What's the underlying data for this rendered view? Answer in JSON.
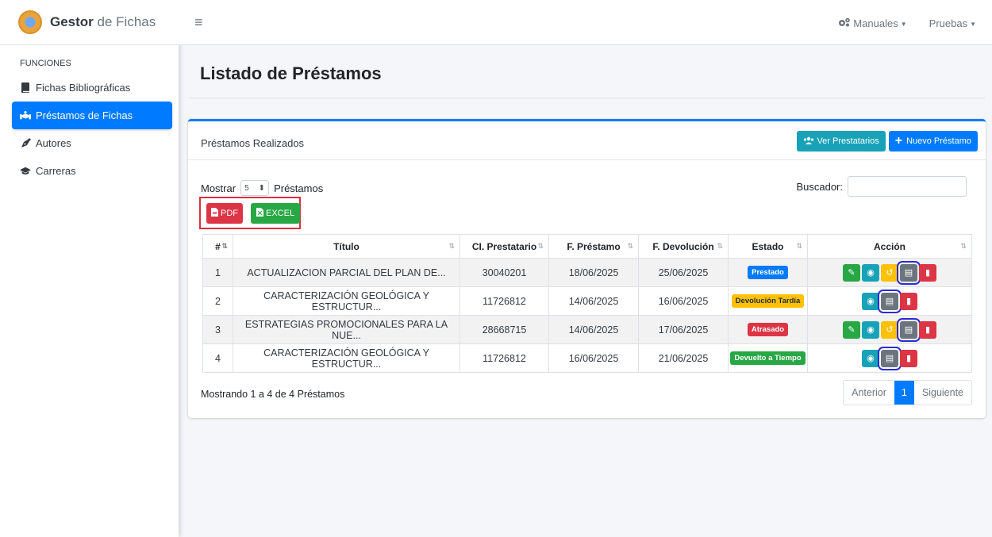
{
  "brand": {
    "bold": "Gestor",
    "rest": "de Fichas"
  },
  "sidebar": {
    "header": "FUNCIONES",
    "items": [
      {
        "label": "Fichas Bibliográficas",
        "icon": "book-icon",
        "active": false
      },
      {
        "label": "Préstamos de Fichas",
        "icon": "hands-icon",
        "active": true
      },
      {
        "label": "Autores",
        "icon": "pen-nib-icon",
        "active": false
      },
      {
        "label": "Carreras",
        "icon": "graduation-cap-icon",
        "active": false
      }
    ]
  },
  "topbar": {
    "manuals": "Manuales",
    "user": "Pruebas"
  },
  "page": {
    "title": "Listado de Préstamos"
  },
  "card": {
    "title": "Préstamos Realizados",
    "ver_prestatarios": "Ver Prestatarios",
    "nuevo_prestamo": "Nuevo Préstamo",
    "show_label": "Mostrar",
    "show_value": "5",
    "show_suffix": "Préstamos",
    "search_label": "Buscador:",
    "pdf_label": "PDF",
    "excel_label": "EXCEL"
  },
  "table": {
    "headers": [
      "#",
      "Título",
      "CI. Prestatario",
      "F. Préstamo",
      "F. Devolución",
      "Estado",
      "Acción"
    ],
    "rows": [
      {
        "n": "1",
        "titulo": "ACTUALIZACION PARCIAL DEL PLAN DE...",
        "ci": "30040201",
        "prestamo": "18/06/2025",
        "devolucion": "25/06/2025",
        "estado": "Prestado",
        "color": "#007bff"
      },
      {
        "n": "2",
        "titulo": "CARACTERIZACIÓN GEOLÓGICA Y ESTRUCTUR...",
        "ci": "11726812",
        "prestamo": "14/06/2025",
        "devolucion": "16/06/2025",
        "estado": "Devolución Tardía",
        "color": "#ffc107"
      },
      {
        "n": "3",
        "titulo": "ESTRATEGIAS PROMOCIONALES PARA LA NUE...",
        "ci": "28668715",
        "prestamo": "14/06/2025",
        "devolucion": "17/06/2025",
        "estado": "Atrasado",
        "color": "#dc3545"
      },
      {
        "n": "4",
        "titulo": "CARACTERIZACIÓN GEOLÓGICA Y ESTRUCTUR...",
        "ci": "11726812",
        "prestamo": "16/06/2025",
        "devolucion": "21/06/2025",
        "estado": "Devuelto a Tiempo",
        "color": "#28a745"
      }
    ]
  },
  "footer": {
    "info": "Mostrando 1 a 4 de 4 Préstamos",
    "prev": "Anterior",
    "page": "1",
    "next": "Siguiente"
  }
}
